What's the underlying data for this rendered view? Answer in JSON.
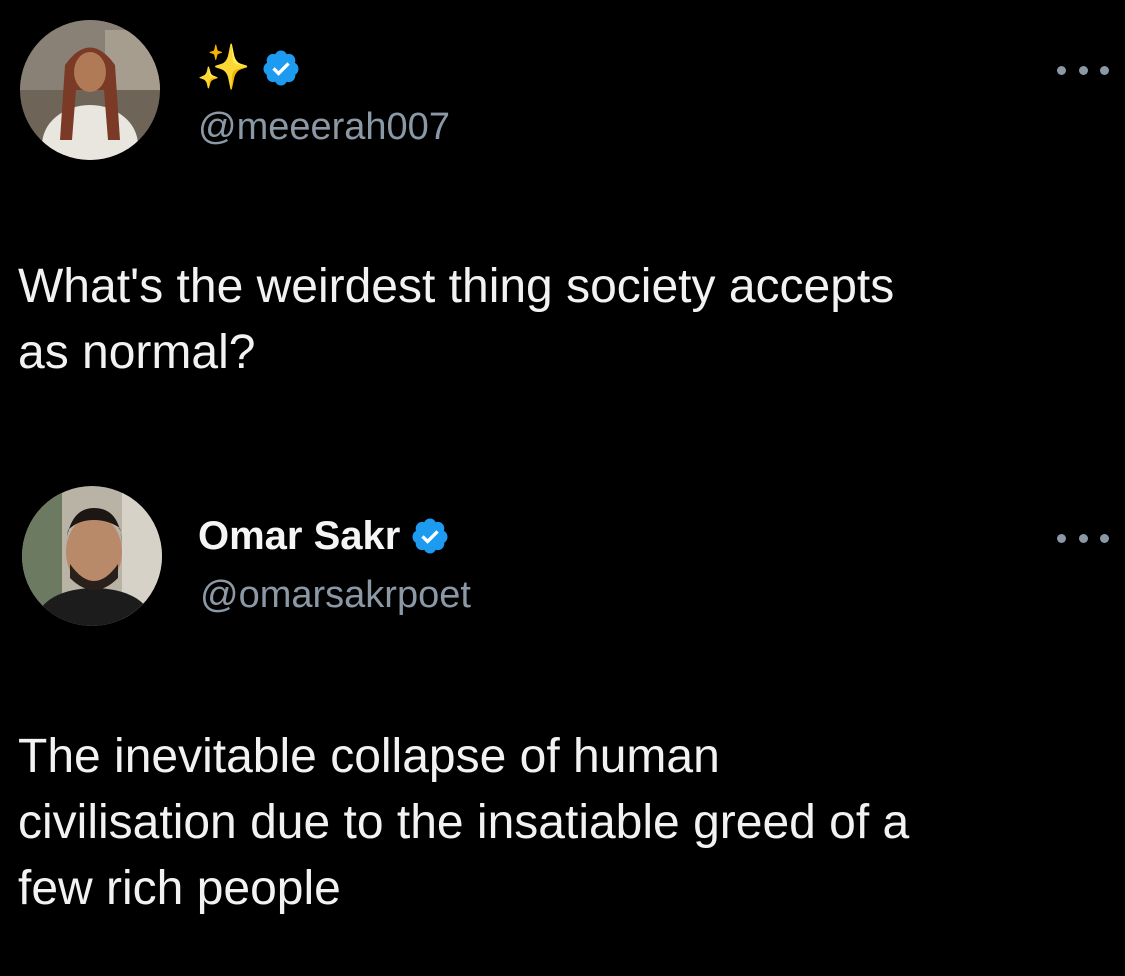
{
  "posts": [
    {
      "display_name": "✨",
      "handle": "@meeerah007",
      "text": "What's the weirdest thing society accepts\nas normal?"
    },
    {
      "display_name": "Omar Sakr",
      "handle": "@omarsakrpoet",
      "text": "The inevitable collapse of human\ncivilisation due to the insatiable greed of a\nfew rich people"
    }
  ],
  "icons": {
    "verified": "verified-badge-icon",
    "more": "more-options-icon"
  },
  "colors": {
    "background": "#000000",
    "text": "#e7e9ea",
    "secondary_text": "#8b98a5",
    "verified_blue": "#1d9bf0"
  }
}
